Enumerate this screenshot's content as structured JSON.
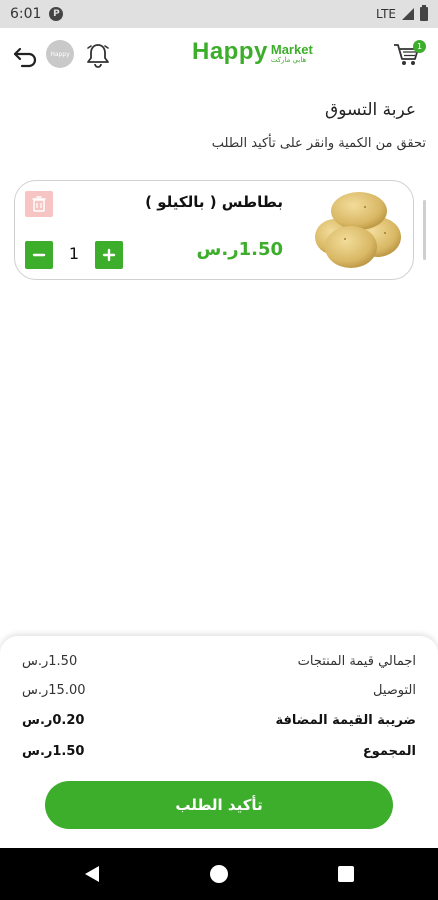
{
  "status_bar": {
    "time": "6:01",
    "network": "LTE"
  },
  "header": {
    "avatar_text": "Happy",
    "logo_word1": "Happy",
    "logo_word2": "Market",
    "logo_sub": "هابي ماركت",
    "cart_count": "1"
  },
  "page": {
    "title": "عربة التسوق",
    "subtitle": "تحقق من الكمية وانقر على تأكيد الطلب"
  },
  "cart_items": [
    {
      "name": "بطاطس ( بالكيلو )",
      "price": "1.50ر.س",
      "quantity": "1",
      "image_icon": "potato-image"
    }
  ],
  "summary": {
    "rows": [
      {
        "label": "اجمالي قيمة المنتجات",
        "value": "1.50ر.س"
      },
      {
        "label": "التوصيل",
        "value": "15.00ر.س"
      },
      {
        "label": "ضريبة القيمة المضافة",
        "value": "0.20ر.س"
      },
      {
        "label": "المجموع",
        "value": "1.50ر.س"
      }
    ],
    "confirm_label": "تأكيد الطلب"
  },
  "colors": {
    "accent": "#3dae2b",
    "delete_bg": "#f7c4c4"
  }
}
